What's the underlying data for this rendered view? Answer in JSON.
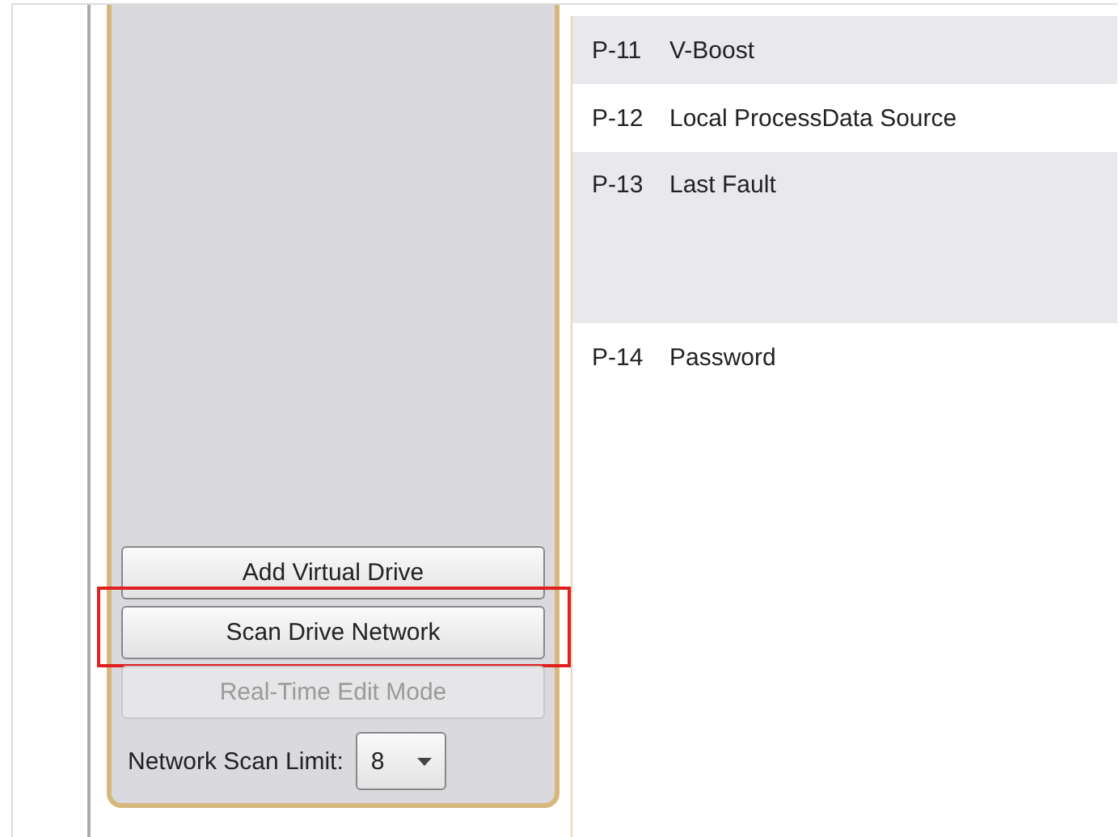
{
  "sidebar": {
    "buttons": [
      {
        "label": "Add Virtual Drive",
        "disabled": false,
        "highlighted": false
      },
      {
        "label": "Scan Drive Network",
        "disabled": false,
        "highlighted": true
      },
      {
        "label": "Real-Time Edit Mode",
        "disabled": true,
        "highlighted": false
      }
    ],
    "scan_limit": {
      "label": "Network Scan Limit:",
      "value": "8"
    }
  },
  "parameters": [
    {
      "code": "P-11",
      "name": "V-Boost"
    },
    {
      "code": "P-12",
      "name": "Local ProcessData Source"
    },
    {
      "code": "P-13",
      "name": "Last Fault",
      "tall": true
    },
    {
      "code": "P-14",
      "name": "Password"
    }
  ]
}
